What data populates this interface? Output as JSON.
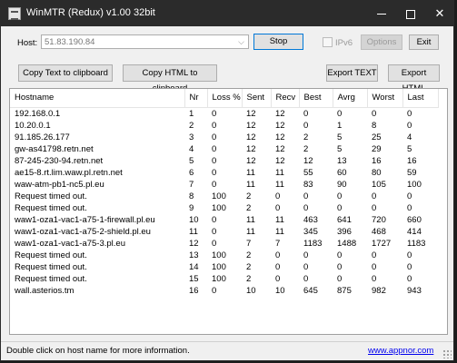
{
  "window": {
    "title": "WinMTR (Redux) v1.00 32bit"
  },
  "host": {
    "label": "Host:",
    "value": "51.83.190.84"
  },
  "toolbar": {
    "stop_label": "Stop",
    "ipv6_label": "IPv6",
    "options_label": "Options",
    "exit_label": "Exit",
    "copy_text_label": "Copy Text to clipboard",
    "copy_html_label": "Copy HTML to clipboard",
    "export_text_label": "Export TEXT",
    "export_html_label": "Export HTML"
  },
  "table": {
    "columns": [
      "Hostname",
      "Nr",
      "Loss %",
      "Sent",
      "Recv",
      "Best",
      "Avrg",
      "Worst",
      "Last"
    ],
    "rows": [
      [
        "192.168.0.1",
        "1",
        "0",
        "12",
        "12",
        "0",
        "0",
        "0",
        "0"
      ],
      [
        "10.20.0.1",
        "2",
        "0",
        "12",
        "12",
        "0",
        "1",
        "8",
        "0"
      ],
      [
        "91.185.26.177",
        "3",
        "0",
        "12",
        "12",
        "2",
        "5",
        "25",
        "4"
      ],
      [
        "gw-as41798.retn.net",
        "4",
        "0",
        "12",
        "12",
        "2",
        "5",
        "29",
        "5"
      ],
      [
        "87-245-230-94.retn.net",
        "5",
        "0",
        "12",
        "12",
        "12",
        "13",
        "16",
        "16"
      ],
      [
        "ae15-8.rt.lim.waw.pl.retn.net",
        "6",
        "0",
        "11",
        "11",
        "55",
        "60",
        "80",
        "59"
      ],
      [
        "waw-atm-pb1-nc5.pl.eu",
        "7",
        "0",
        "11",
        "11",
        "83",
        "90",
        "105",
        "100"
      ],
      [
        "Request timed out.",
        "8",
        "100",
        "2",
        "0",
        "0",
        "0",
        "0",
        "0"
      ],
      [
        "Request timed out.",
        "9",
        "100",
        "2",
        "0",
        "0",
        "0",
        "0",
        "0"
      ],
      [
        "waw1-oza1-vac1-a75-1-firewall.pl.eu",
        "10",
        "0",
        "11",
        "11",
        "463",
        "641",
        "720",
        "660"
      ],
      [
        "waw1-oza1-vac1-a75-2-shield.pl.eu",
        "11",
        "0",
        "11",
        "11",
        "345",
        "396",
        "468",
        "414"
      ],
      [
        "waw1-oza1-vac1-a75-3.pl.eu",
        "12",
        "0",
        "7",
        "7",
        "1183",
        "1488",
        "1727",
        "1183"
      ],
      [
        "Request timed out.",
        "13",
        "100",
        "2",
        "0",
        "0",
        "0",
        "0",
        "0"
      ],
      [
        "Request timed out.",
        "14",
        "100",
        "2",
        "0",
        "0",
        "0",
        "0",
        "0"
      ],
      [
        "Request timed out.",
        "15",
        "100",
        "2",
        "0",
        "0",
        "0",
        "0",
        "0"
      ],
      [
        "wall.asterios.tm",
        "16",
        "0",
        "10",
        "10",
        "645",
        "875",
        "982",
        "943"
      ]
    ]
  },
  "status": {
    "message": "Double click on host name for more information.",
    "link": "www.appnor.com"
  }
}
